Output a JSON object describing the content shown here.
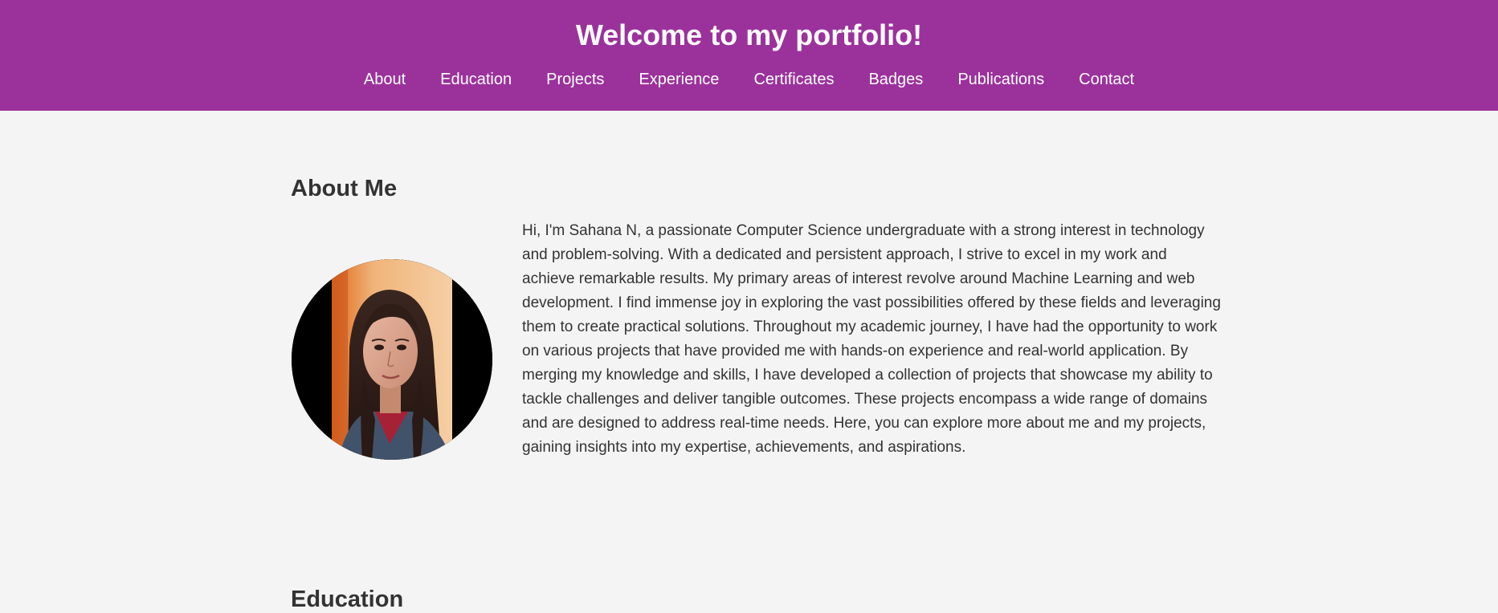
{
  "header": {
    "title": "Welcome to my portfolio!",
    "nav": [
      {
        "label": "About"
      },
      {
        "label": "Education"
      },
      {
        "label": "Projects"
      },
      {
        "label": "Experience"
      },
      {
        "label": "Certificates"
      },
      {
        "label": "Badges"
      },
      {
        "label": "Publications"
      },
      {
        "label": "Contact"
      }
    ]
  },
  "about": {
    "title": "About Me",
    "text": "Hi, I'm Sahana N, a passionate Computer Science undergraduate with a strong interest in technology and problem-solving. With a dedicated and persistent approach, I strive to excel in my work and achieve remarkable results. My primary areas of interest revolve around Machine Learning and web development. I find immense joy in exploring the vast possibilities offered by these fields and leveraging them to create practical solutions. Throughout my academic journey, I have had the opportunity to work on various projects that have provided me with hands-on experience and real-world application. By merging my knowledge and skills, I have developed a collection of projects that showcase my ability to tackle challenges and deliver tangible outcomes. These projects encompass a wide range of domains and are designed to address real-time needs. Here, you can explore more about me and my projects, gaining insights into my expertise, achievements, and aspirations."
  },
  "education": {
    "title": "Education"
  },
  "colors": {
    "header_background": "#9b329c",
    "page_background": "#f4f4f4",
    "text": "#333333",
    "header_text": "#ffffff"
  }
}
